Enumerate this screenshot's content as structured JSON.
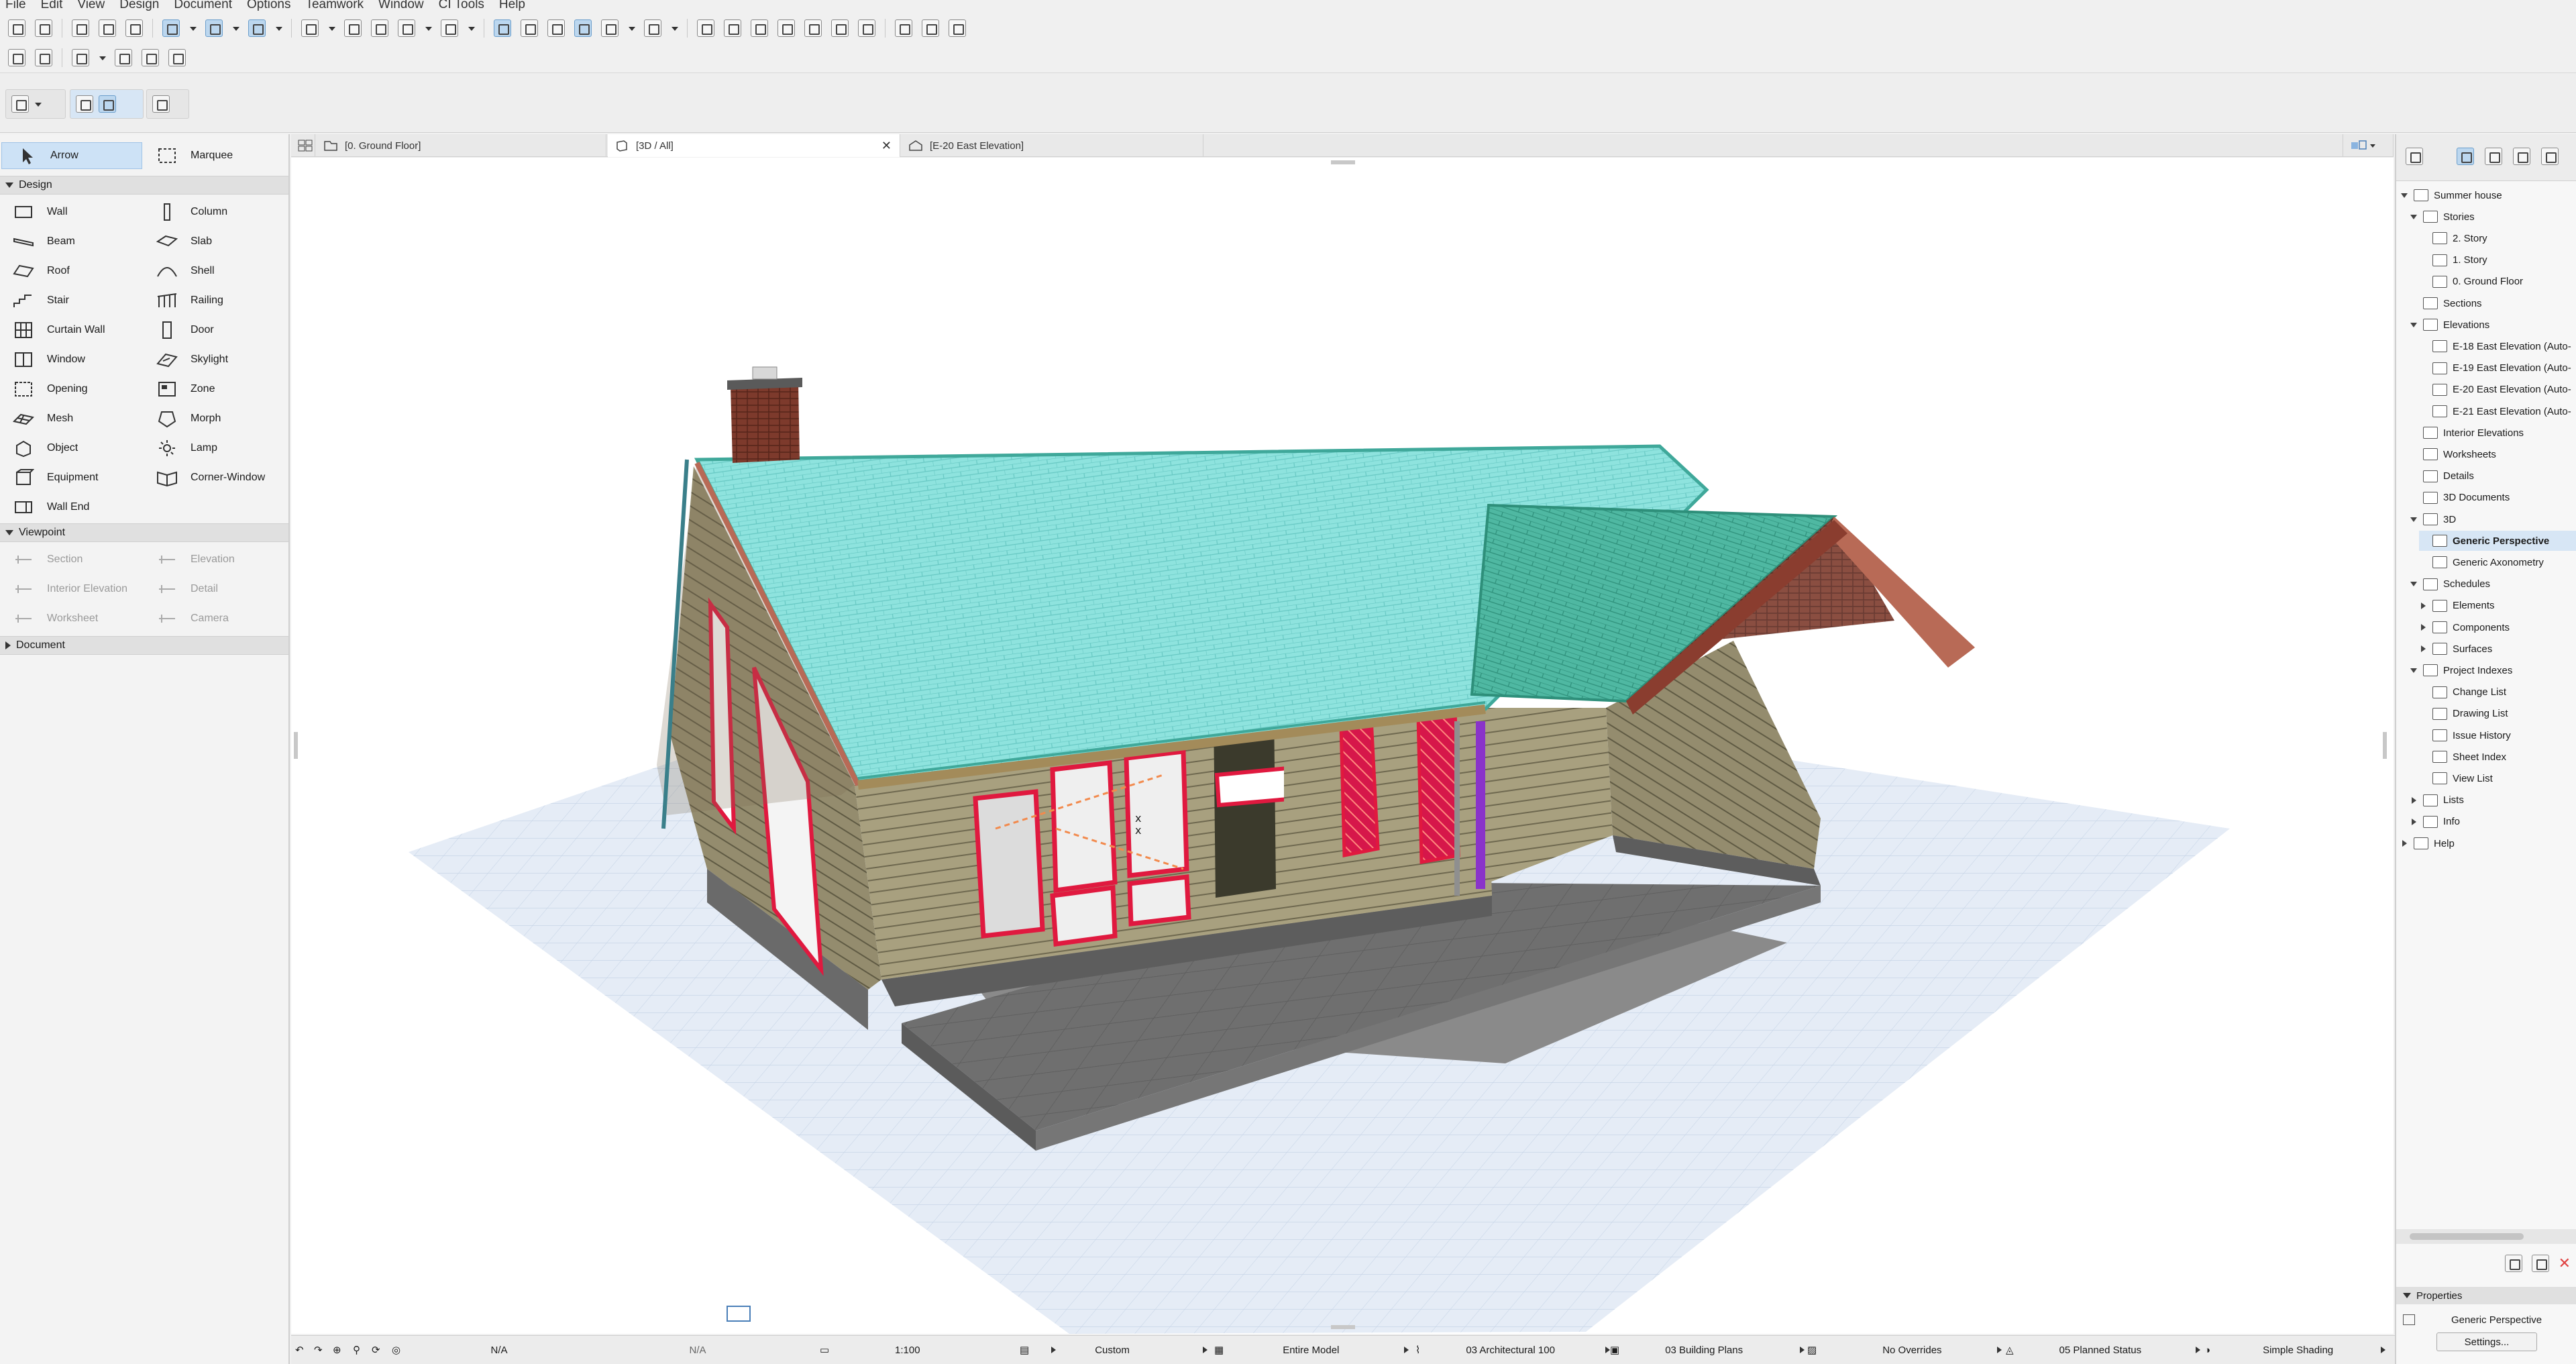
{
  "menu": [
    "File",
    "Edit",
    "View",
    "Design",
    "Document",
    "Options",
    "Teamwork",
    "Window",
    "CI Tools",
    "Help"
  ],
  "toolbox": {
    "arrow_label": "Arrow",
    "marquee_label": "Marquee",
    "sections": {
      "design": "Design",
      "viewpoint": "Viewpoint",
      "document": "Document"
    },
    "design_tools": [
      {
        "label": "Wall",
        "icon": "wall-icon"
      },
      {
        "label": "Column",
        "icon": "column-icon"
      },
      {
        "label": "Beam",
        "icon": "beam-icon"
      },
      {
        "label": "Slab",
        "icon": "slab-icon"
      },
      {
        "label": "Roof",
        "icon": "roof-icon"
      },
      {
        "label": "Shell",
        "icon": "shell-icon"
      },
      {
        "label": "Stair",
        "icon": "stair-icon"
      },
      {
        "label": "Railing",
        "icon": "railing-icon"
      },
      {
        "label": "Curtain Wall",
        "icon": "curtain-wall-icon"
      },
      {
        "label": "Door",
        "icon": "door-icon"
      },
      {
        "label": "Window",
        "icon": "window-icon"
      },
      {
        "label": "Skylight",
        "icon": "skylight-icon"
      },
      {
        "label": "Opening",
        "icon": "opening-icon"
      },
      {
        "label": "Zone",
        "icon": "zone-icon"
      },
      {
        "label": "Mesh",
        "icon": "mesh-icon"
      },
      {
        "label": "Morph",
        "icon": "morph-icon"
      },
      {
        "label": "Object",
        "icon": "object-icon"
      },
      {
        "label": "Lamp",
        "icon": "lamp-icon"
      },
      {
        "label": "Equipment",
        "icon": "equipment-icon"
      },
      {
        "label": "Corner-Window",
        "icon": "corner-window-icon"
      },
      {
        "label": "Wall End",
        "icon": "wall-end-icon"
      }
    ],
    "viewpoint_tools": [
      {
        "label": "Section",
        "icon": "section-icon"
      },
      {
        "label": "Elevation",
        "icon": "elevation-icon"
      },
      {
        "label": "Interior Elevation",
        "icon": "interior-elevation-icon"
      },
      {
        "label": "Detail",
        "icon": "detail-icon"
      },
      {
        "label": "Worksheet",
        "icon": "worksheet-icon"
      },
      {
        "label": "Camera",
        "icon": "camera-icon"
      }
    ]
  },
  "tabs": [
    {
      "label": "[0. Ground Floor]",
      "active": false
    },
    {
      "label": "[3D / All]",
      "active": true
    },
    {
      "label": "[E-20 East Elevation]",
      "active": false
    }
  ],
  "navigator": {
    "project": "Summer house",
    "stories_label": "Stories",
    "stories": [
      "2. Story",
      "1. Story",
      "0. Ground Floor"
    ],
    "sections_label": "Sections",
    "elevations_label": "Elevations",
    "elevations": [
      "E-18 East Elevation (Auto-",
      "E-19 East Elevation (Auto-",
      "E-20 East Elevation (Auto-",
      "E-21 East Elevation (Auto-"
    ],
    "interior_elevations": "Interior Elevations",
    "worksheets": "Worksheets",
    "details": "Details",
    "documents_3d": "3D Documents",
    "view_3d": "3D",
    "generic_perspective": "Generic Perspective",
    "generic_axonometry": "Generic Axonometry",
    "schedules": "Schedules",
    "elements": "Elements",
    "components": "Components",
    "surfaces": "Surfaces",
    "project_indexes": "Project Indexes",
    "change_list": "Change List",
    "drawing_list": "Drawing List",
    "issue_history": "Issue History",
    "sheet_index": "Sheet Index",
    "view_list": "View List",
    "lists": "Lists",
    "info": "Info",
    "help": "Help",
    "properties_label": "Properties",
    "properties_value": "Generic Perspective",
    "settings_button": "Settings..."
  },
  "statusbar": {
    "na1": "N/A",
    "na2": "N/A",
    "scale": "1:100",
    "pen_set": "Custom",
    "model_filter": "Entire Model",
    "layer_combo": "03 Architectural 100",
    "model_view": "03 Building Plans",
    "overrides": "No Overrides",
    "renovation": "05 Planned Status",
    "shading": "Simple Shading"
  },
  "colors": {
    "selection": "#cde2f6",
    "roof": "#8ee3de",
    "roof_dark": "#3fa89a",
    "siding": "#a39a7c",
    "door_red": "#d6174a",
    "brick": "#8a3d2f",
    "grid_blue": "#dfe7f2",
    "downspout": "#8a33c9"
  }
}
